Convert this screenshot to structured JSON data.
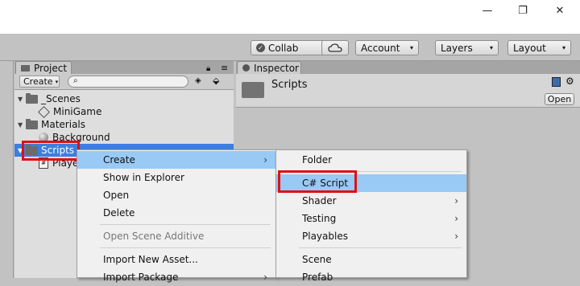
{
  "window": {
    "minimize_glyph": "—",
    "maximize_glyph": "❐",
    "close_glyph": "✕"
  },
  "toolbar": {
    "collab_label": "Collab",
    "account_label": "Account",
    "layers_label": "Layers",
    "layout_label": "Layout",
    "caret": "▾"
  },
  "project": {
    "tab_label": "Project",
    "create_label": "Create",
    "tree": [
      {
        "label": "_Scenes"
      },
      {
        "label": "MiniGame"
      },
      {
        "label": "Materials"
      },
      {
        "label": "Background"
      },
      {
        "label": "Scripts"
      },
      {
        "label": "Playe"
      }
    ]
  },
  "inspector": {
    "tab_label": "Inspector",
    "title": "Scripts",
    "open_label": "Open"
  },
  "context_menu": {
    "items": [
      {
        "label": "Create",
        "submenu": "›"
      },
      {
        "label": "Show in Explorer"
      },
      {
        "label": "Open"
      },
      {
        "label": "Delete"
      },
      {
        "label": "Open Scene Additive"
      },
      {
        "label": "Import New Asset..."
      },
      {
        "label": "Import Package",
        "submenu": "›"
      }
    ]
  },
  "create_submenu": {
    "items": [
      {
        "label": "Folder"
      },
      {
        "label": "C# Script"
      },
      {
        "label": "Shader",
        "submenu": "›"
      },
      {
        "label": "Testing",
        "submenu": "›"
      },
      {
        "label": "Playables",
        "submenu": "›"
      },
      {
        "label": "Scene"
      },
      {
        "label": "Prefab"
      }
    ]
  },
  "colors": {
    "highlight": "#99c9f5",
    "selection": "#3d7ee0",
    "annotation": "#e01010"
  }
}
